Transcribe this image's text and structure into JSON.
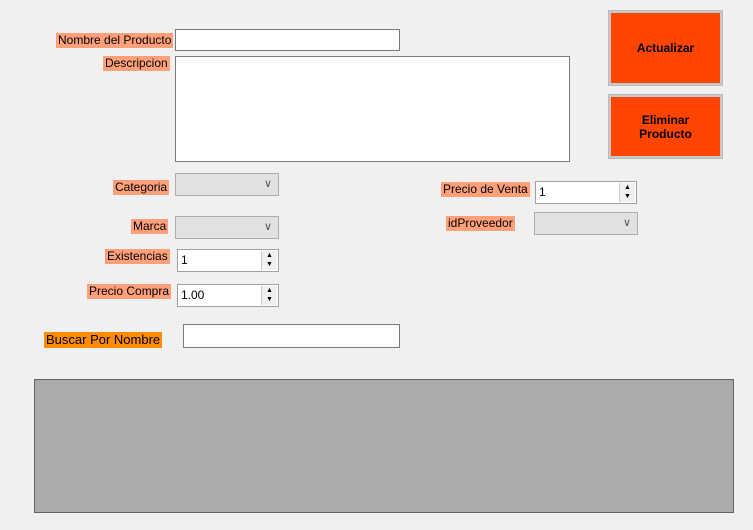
{
  "labels": {
    "nombre": "Nombre del Producto",
    "descripcion": "Descripcion",
    "categoria": "Categoria",
    "marca": "Marca",
    "existencias": "Existencias",
    "precio_compra": "Precio Compra",
    "precio_venta": "Precio de Venta",
    "id_proveedor": "idProveedor",
    "buscar": "Buscar Por Nombre"
  },
  "values": {
    "existencias": "1",
    "precio_compra": "1.00",
    "precio_venta": "1"
  },
  "buttons": {
    "actualizar": "Actualizar",
    "eliminar": "Eliminar Producto"
  },
  "colors": {
    "label_bg": "#ffa07a",
    "search_label_bg": "#ff8c00",
    "button_bg": "#ff4500",
    "grid_bg": "#ababab"
  }
}
